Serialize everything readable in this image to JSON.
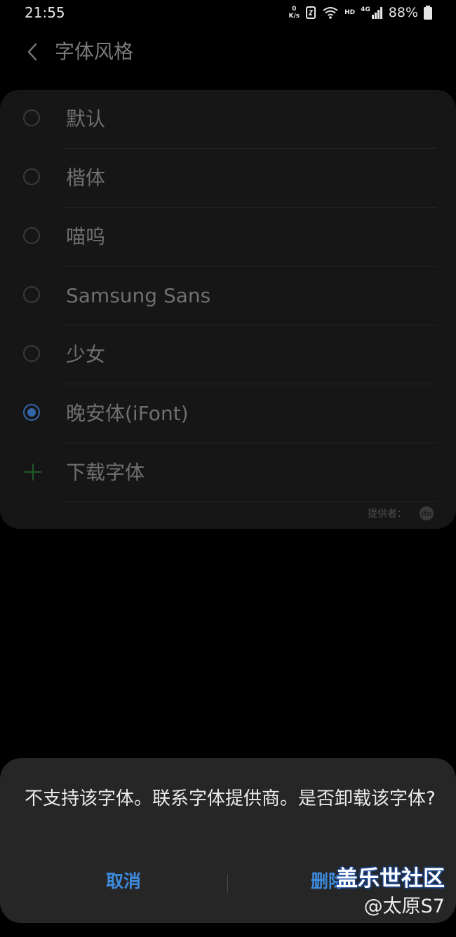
{
  "status_bar": {
    "time": "21:55",
    "net_speed_value": "0",
    "net_speed_unit": "K/s",
    "network_type": "HD",
    "signal_type": "4G",
    "battery_percent": "88%"
  },
  "header": {
    "back_icon": "chevron-left-icon",
    "title": "字体风格"
  },
  "font_list": {
    "items": [
      {
        "label": "默认",
        "selected": false
      },
      {
        "label": "楷体",
        "selected": false
      },
      {
        "label": "喵呜",
        "selected": false
      },
      {
        "label": "Samsung Sans",
        "selected": false
      },
      {
        "label": "少女",
        "selected": false
      },
      {
        "label": "晚安体(iFont)",
        "selected": true
      }
    ],
    "download_label": "下载字体",
    "provider_label": "提供者：",
    "provider_logo_text": "ifo"
  },
  "dialog": {
    "message": "不支持该字体。联系字体提供商。是否卸载该字体?",
    "cancel_label": "取消",
    "delete_label": "删除"
  },
  "watermark": {
    "title": "盖乐世社区",
    "subtitle": "@太原S7"
  },
  "colors": {
    "accent": "#3d8bde",
    "radio_selected": "#3467a8",
    "plus_icon": "#1f5a2c",
    "card_bg": "#161616",
    "dialog_bg": "#262626"
  }
}
